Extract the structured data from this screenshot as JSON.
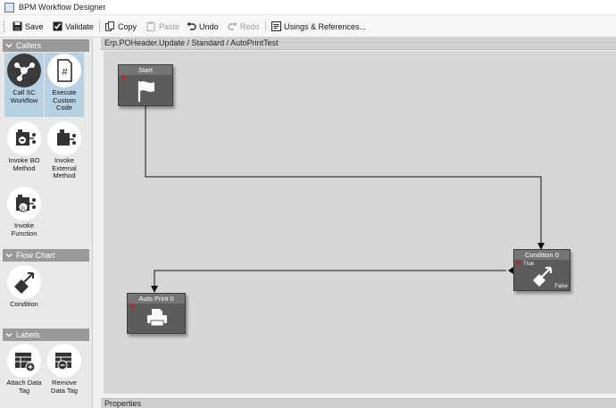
{
  "window": {
    "title": "BPM Workflow Designer"
  },
  "toolbar": {
    "save": "Save",
    "validate": "Validate",
    "copy": "Copy",
    "paste": "Paste",
    "undo": "Undo",
    "redo": "Redo",
    "usings": "Usings & References..."
  },
  "palette": {
    "callers": {
      "header": "Callers",
      "items": [
        {
          "label": "Call SC Workflow",
          "icon": "workflow-icon",
          "selected": true
        },
        {
          "label": "Execute Custom Code",
          "icon": "code-file-icon"
        },
        {
          "label": "Invoke BO Method",
          "icon": "bo-method-icon"
        },
        {
          "label": "Invoke External Method",
          "icon": "external-method-icon"
        },
        {
          "label": "Invoke Function",
          "icon": "function-icon"
        }
      ]
    },
    "flow_chart": {
      "header": "Flow Chart",
      "items": [
        {
          "label": "Condition",
          "icon": "condition-icon"
        }
      ]
    },
    "labels": {
      "header": "Labels",
      "items": [
        {
          "label": "Attach Data Tag",
          "icon": "attach-tag-icon"
        },
        {
          "label": "Remove Data Tag",
          "icon": "remove-tag-icon"
        }
      ]
    }
  },
  "canvas": {
    "breadcrumb": "Erp.POHeader.Update / Standard / AutoPrintTest",
    "properties_label": "Properties",
    "nodes": {
      "start": {
        "title": "Start",
        "icon": "flag-icon"
      },
      "condition": {
        "title": "Condition 0",
        "true_label": "True",
        "false_label": "False",
        "icon": "condition-icon"
      },
      "auto_print": {
        "title": "Auto Print 0",
        "icon": "printer-icon"
      }
    }
  },
  "colors": {
    "node_body": "#5c5c5c",
    "node_title": "#757575",
    "canvas_bg": "#d6d6d6",
    "category_header": "#999999",
    "selected_tool": "#b7d0e2",
    "add_marker": "#e01010"
  }
}
